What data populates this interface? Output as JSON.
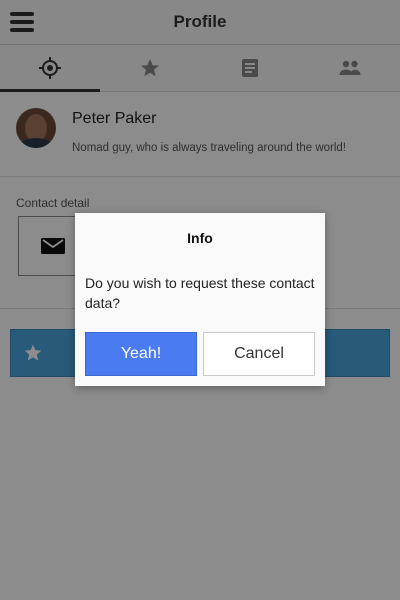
{
  "header": {
    "title": "Profile",
    "menu_icon": "hamburger-menu-icon"
  },
  "tabs": [
    {
      "icon": "location-target-icon",
      "active": true
    },
    {
      "icon": "star-icon",
      "active": false
    },
    {
      "icon": "document-icon",
      "active": false
    },
    {
      "icon": "people-icon",
      "active": false
    }
  ],
  "profile": {
    "name": "Peter Paker",
    "bio": "Nomad guy, who is always traveling around the world!"
  },
  "contact": {
    "label": "Contact detail",
    "items": [
      "email-icon",
      "twitter-icon",
      "phone-icon"
    ]
  },
  "favorite": {
    "icon": "star-icon",
    "color": "#4aa5dd"
  },
  "dialog": {
    "title": "Info",
    "message": "Do you wish to request these contact data?",
    "confirm_label": "Yeah!",
    "cancel_label": "Cancel",
    "confirm_color": "#4b7bf0"
  },
  "colors": {
    "overlay": "rgba(0,0,0,0.45)",
    "primary": "#4b7bf0",
    "accent": "#4aa5dd"
  }
}
